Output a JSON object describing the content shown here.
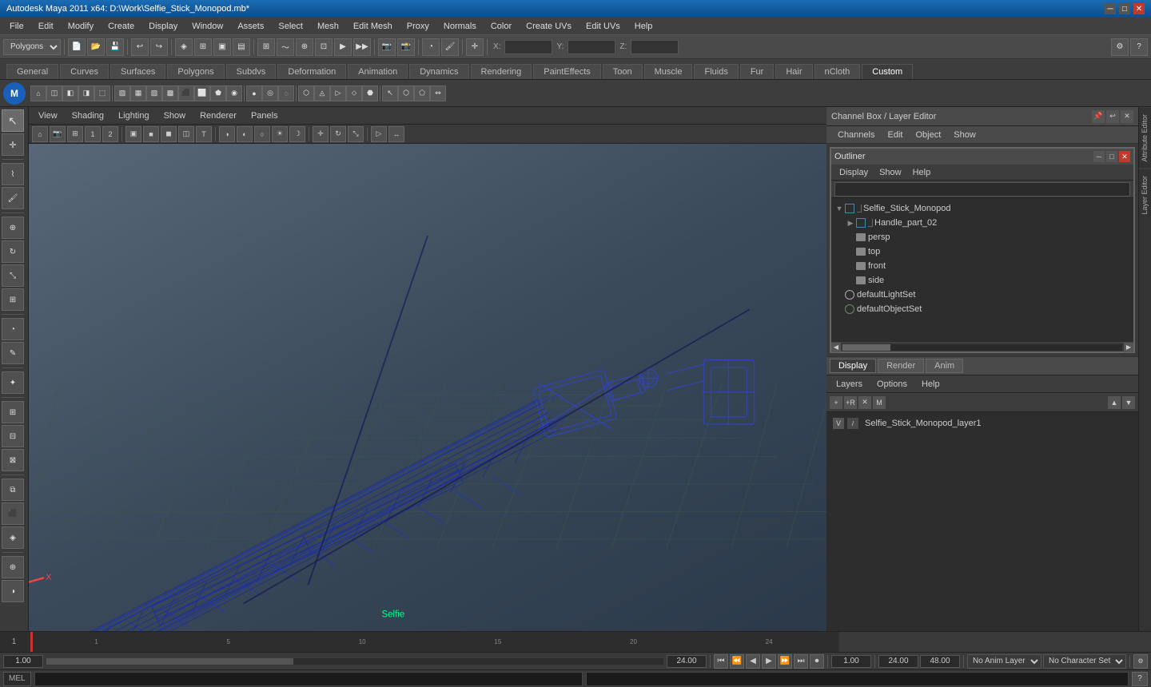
{
  "titlebar": {
    "title": "Autodesk Maya 2011 x64: D:\\Work\\Selfie_Stick_Monopod.mb*",
    "minimize": "─",
    "maximize": "□",
    "close": "✕"
  },
  "menubar": {
    "items": [
      "File",
      "Edit",
      "Modify",
      "Create",
      "Display",
      "Window",
      "Assets",
      "Select",
      "Mesh",
      "Edit Mesh",
      "Proxy",
      "Normals",
      "Color",
      "Create UVs",
      "Edit UVs",
      "Help"
    ]
  },
  "toolbar": {
    "mode_select": "Polygons",
    "z_label": "Z:",
    "x_label": "X:",
    "y_label": "Y:"
  },
  "module_tabs": {
    "items": [
      "General",
      "Curves",
      "Surfaces",
      "Polygons",
      "Subdvs",
      "Deformation",
      "Animation",
      "Dynamics",
      "Rendering",
      "PaintEffects",
      "Toon",
      "Muscle",
      "Fluids",
      "Fur",
      "Hair",
      "nCloth",
      "Custom"
    ],
    "active": "Custom"
  },
  "viewport": {
    "menus": [
      "View",
      "Shading",
      "Lighting",
      "Show",
      "Renderer",
      "Panels"
    ],
    "selfie_label": "Selfie"
  },
  "outliner": {
    "title": "Outliner",
    "menus": [
      "Display",
      "Show",
      "Help"
    ],
    "search_placeholder": "",
    "tree_items": [
      {
        "id": "selfie_stick",
        "label": "Selfie_Stick_Monopod",
        "type": "mesh",
        "expanded": true,
        "indent": 0
      },
      {
        "id": "handle_part",
        "label": "Handle_part_02",
        "type": "mesh",
        "expanded": false,
        "indent": 1
      },
      {
        "id": "persp",
        "label": "persp",
        "type": "camera",
        "indent": 1
      },
      {
        "id": "top",
        "label": "top",
        "type": "camera",
        "indent": 1
      },
      {
        "id": "front",
        "label": "front",
        "type": "camera",
        "indent": 1
      },
      {
        "id": "side",
        "label": "side",
        "type": "camera",
        "indent": 1
      },
      {
        "id": "defaultLightSet",
        "label": "defaultLightSet",
        "type": "light",
        "indent": 0
      },
      {
        "id": "defaultObjectSet",
        "label": "defaultObjectSet",
        "type": "set",
        "indent": 0
      }
    ]
  },
  "channelbox": {
    "header_title": "Channel Box / Layer Editor",
    "tabs": [
      "Display",
      "Render",
      "Anim"
    ],
    "active_tab": "Display",
    "submenus": [
      "Layers",
      "Options",
      "Help"
    ],
    "layer_icons": [
      "new-layer",
      "delete-layer",
      "move-up",
      "move-down"
    ],
    "layers": [
      {
        "visible": "V",
        "name": "Selfie_Stick_Monopod_layer1"
      }
    ]
  },
  "timeline": {
    "start": "1",
    "end": "24",
    "current_frame": "1",
    "playback_start": "1.00",
    "playback_end": "24.00",
    "range_end": "48.00",
    "anim_layer": "No Anim Layer",
    "character_set": "No Character Set",
    "marks": [
      "1",
      "",
      "",
      "",
      "5",
      "",
      "",
      "",
      "",
      "10",
      "",
      "",
      "",
      "",
      "15",
      "",
      "",
      "",
      "",
      "20",
      "",
      "",
      "",
      "24"
    ]
  },
  "playback": {
    "current": "1",
    "buttons": [
      "⏮",
      "⏪",
      "◀",
      "▶",
      "⏩",
      "⏭",
      "⏺"
    ],
    "range_start": "1.00",
    "range_end": "24.00",
    "anim_layer_placeholder": "No Anim Layer",
    "char_set_placeholder": "No Character Set"
  },
  "bottom": {
    "mel_label": "MEL",
    "command_placeholder": ""
  },
  "axis": {
    "x_color": "#ff4444",
    "y_color": "#44ff44",
    "z_color": "#4444ff"
  }
}
